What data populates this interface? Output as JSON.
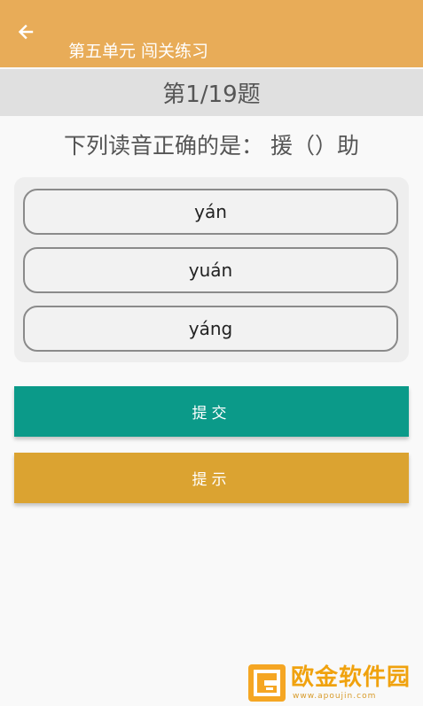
{
  "app_bar": {
    "title": "第五单元  闯关练习",
    "back_icon": "arrow-left-icon",
    "background": "#e8ac58"
  },
  "progress": {
    "label": "第1/19题",
    "current": 1,
    "total": 19
  },
  "question": {
    "text": "下列读音正确的是：  援（）助"
  },
  "options": [
    {
      "label": "yán"
    },
    {
      "label": "yuán"
    },
    {
      "label": "yáng"
    }
  ],
  "buttons": {
    "submit_label": "提交",
    "hint_label": "提示",
    "submit_color": "#0b9a89",
    "hint_color": "#dba331"
  },
  "watermark": {
    "name": "欧金软件园",
    "url": "www.apoujin.com",
    "logo_icon": "apoujin-logo-icon",
    "color": "#f0a20e"
  }
}
